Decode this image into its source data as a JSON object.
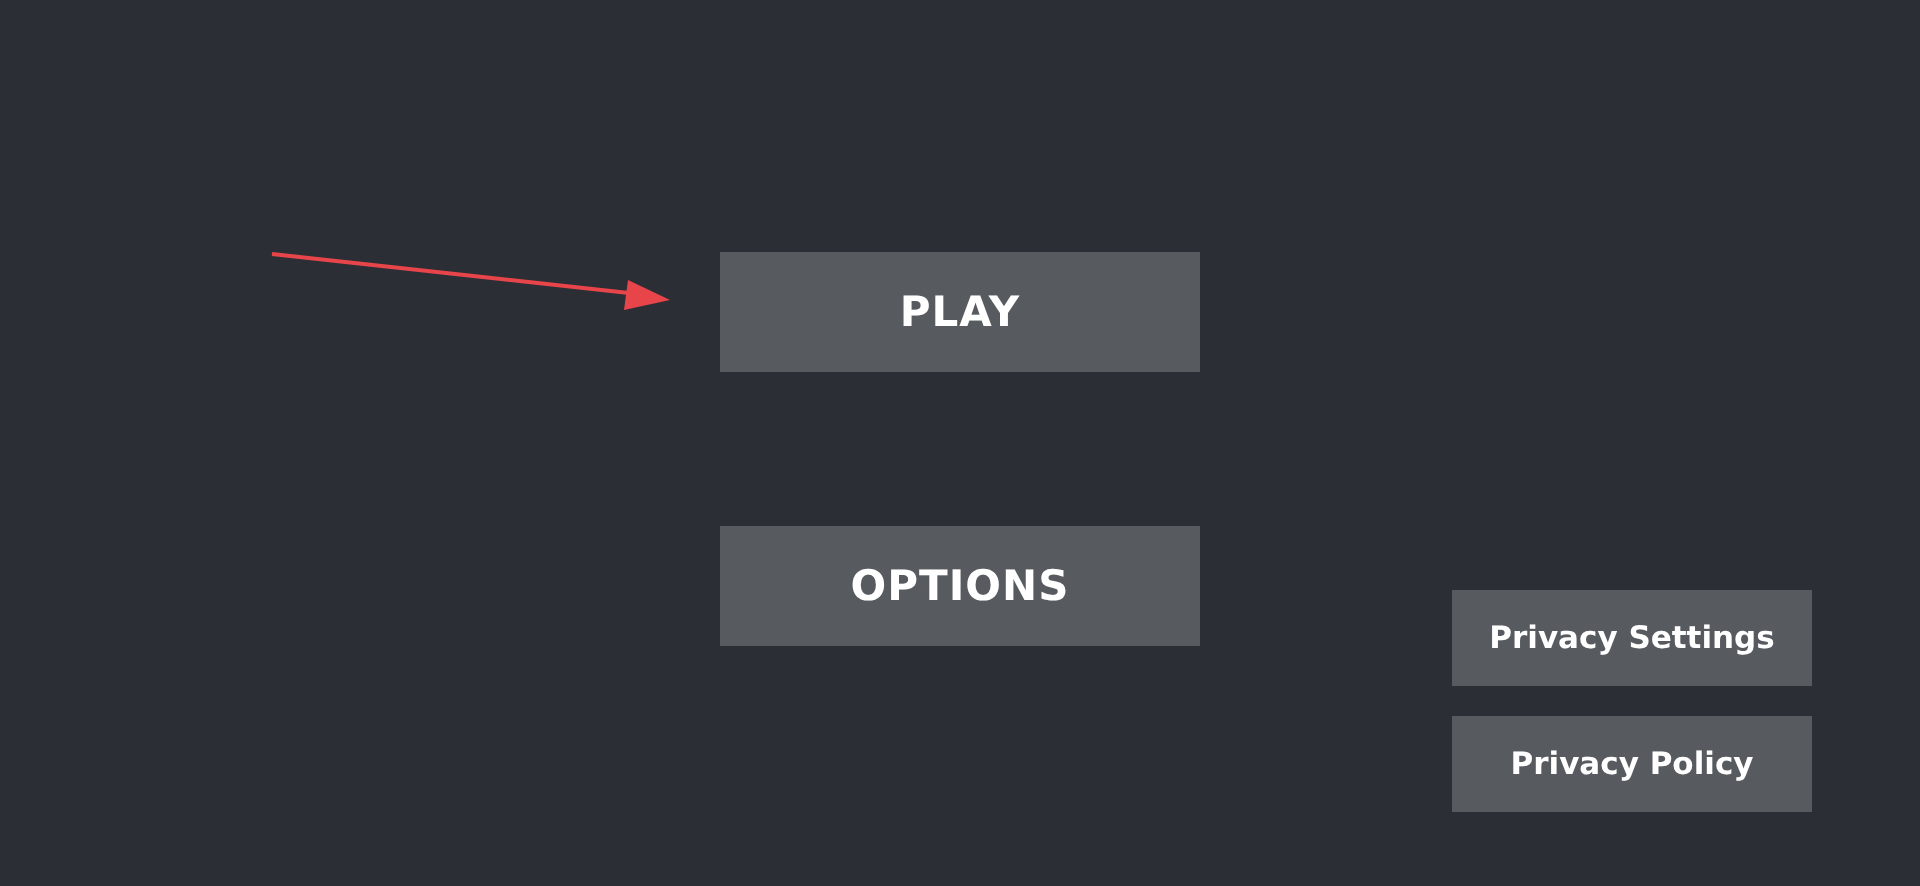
{
  "menu": {
    "buttons": [
      {
        "label": "PLAY"
      },
      {
        "label": "OPTIONS"
      }
    ]
  },
  "privacy": {
    "buttons": [
      {
        "label": "Privacy Settings"
      },
      {
        "label": "Privacy Policy"
      }
    ]
  }
}
